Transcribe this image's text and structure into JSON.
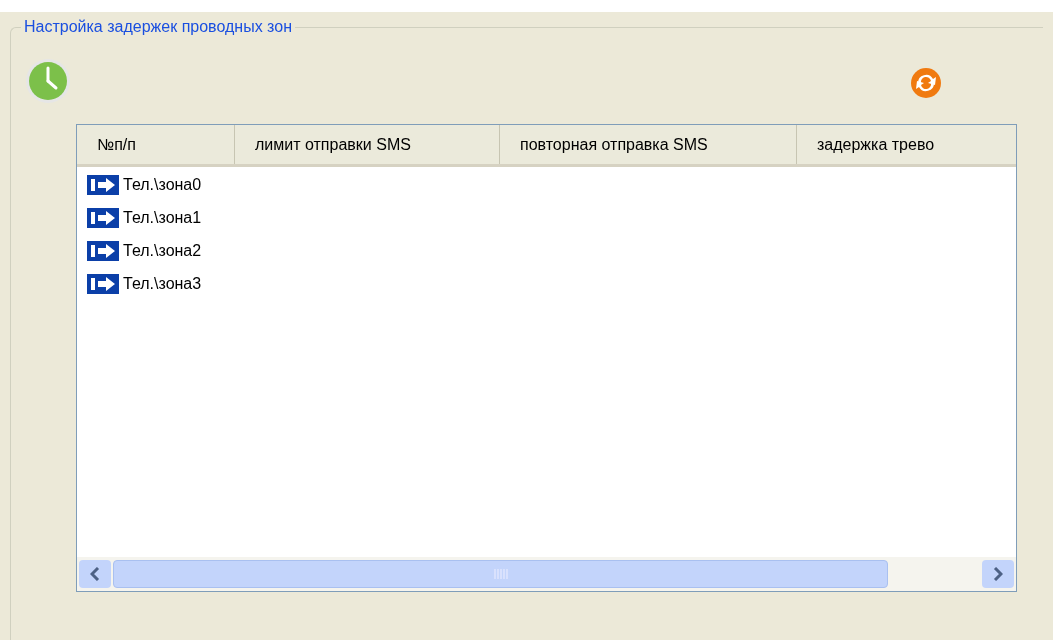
{
  "group": {
    "title": "Настройка задержек проводных зон"
  },
  "table": {
    "columns": [
      "№п/п",
      "лимит отправки SMS",
      "повторная отправка SMS",
      "задержка трево"
    ],
    "rows": [
      {
        "name": "Тел.\\зона0"
      },
      {
        "name": "Тел.\\зона1"
      },
      {
        "name": "Тел.\\зона2"
      },
      {
        "name": "Тел.\\зона3"
      }
    ]
  }
}
